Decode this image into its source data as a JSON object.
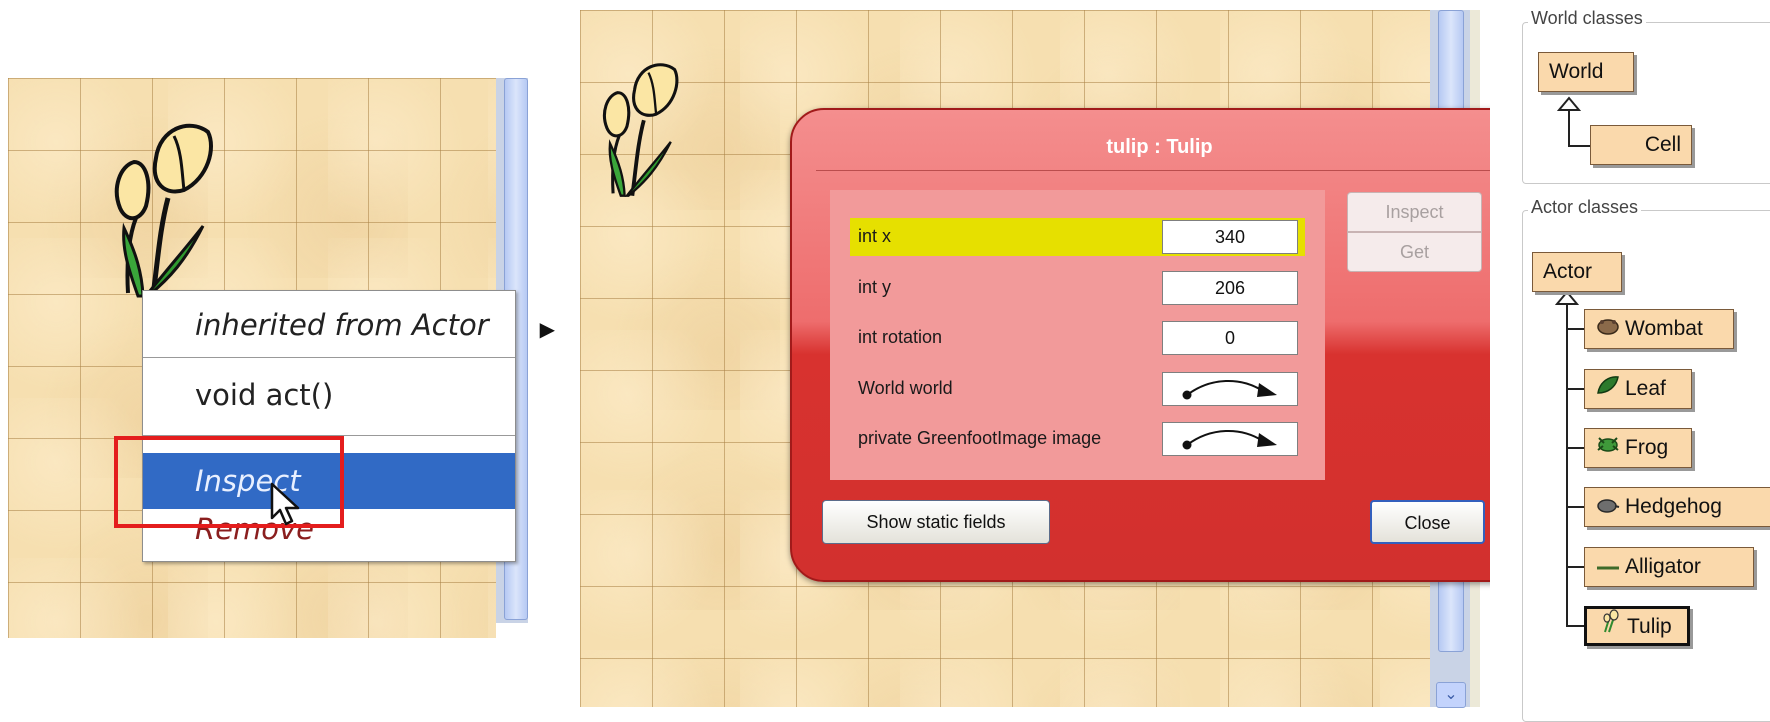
{
  "context_menu": {
    "inherited_label": "inherited from Actor",
    "submenu_arrow": "▶",
    "act_label": "void act()",
    "inspect_label": "Inspect",
    "remove_label": "Remove"
  },
  "inspector": {
    "title": "tulip : Tulip",
    "fields": [
      {
        "label": "int x",
        "value": "340",
        "selected": true
      },
      {
        "label": "int y",
        "value": "206"
      },
      {
        "label": "int rotation",
        "value": "0"
      },
      {
        "label": "World world",
        "value_icon": "reference-arrow-icon"
      },
      {
        "label": "private GreenfootImage image",
        "value_icon": "reference-arrow-icon"
      }
    ],
    "inspect_button": "Inspect",
    "get_button": "Get",
    "show_static_button": "Show static fields",
    "close_button": "Close"
  },
  "class_browser": {
    "world_group_label": "World classes",
    "world_classes": [
      "World",
      "Cell"
    ],
    "actor_group_label": "Actor classes",
    "actor_root": "Actor",
    "actor_subclasses": [
      {
        "name": "Wombat",
        "icon": "wombat-icon"
      },
      {
        "name": "Leaf",
        "icon": "leaf-icon"
      },
      {
        "name": "Frog",
        "icon": "frog-icon"
      },
      {
        "name": "Hedgehog",
        "icon": "hedgehog-icon"
      },
      {
        "name": "Alligator",
        "icon": "alligator-icon"
      },
      {
        "name": "Tulip",
        "icon": "tulip-icon",
        "selected": true
      }
    ]
  },
  "colors": {
    "world_bg": "#f6dfb0",
    "menu_highlight": "#316ac5",
    "dialog_red": "#d8322f",
    "selected_field": "#e6e000",
    "class_box": "#fad9ac",
    "annotation_red": "#e41d1d"
  }
}
